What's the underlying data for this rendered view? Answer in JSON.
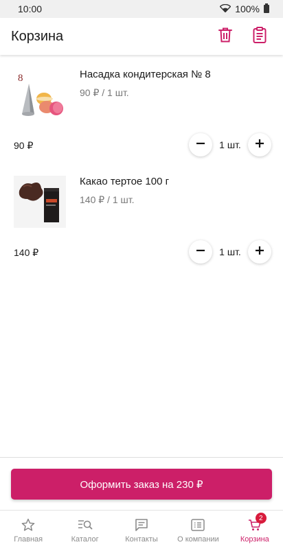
{
  "status_bar": {
    "time": "10:00",
    "battery": "100%"
  },
  "app_bar": {
    "title": "Корзина",
    "icons": [
      "trash-icon",
      "clipboard-icon"
    ]
  },
  "cart": {
    "items": [
      {
        "name": "Насадка кондитерская № 8",
        "unit_price": "90 ₽ / 1 шт.",
        "total": "90 ₽",
        "quantity": "1 шт.",
        "thumb_label": "8"
      },
      {
        "name": "Какао тертое 100 г",
        "unit_price": "140 ₽ / 1 шт.",
        "total": "140 ₽",
        "quantity": "1 шт."
      }
    ]
  },
  "checkout": {
    "label": "Оформить заказ на 230 ₽"
  },
  "bottom_nav": {
    "items": [
      {
        "label": "Главная",
        "icon": "star-icon"
      },
      {
        "label": "Каталог",
        "icon": "catalog-search-icon"
      },
      {
        "label": "Контакты",
        "icon": "chat-icon"
      },
      {
        "label": "О компании",
        "icon": "list-icon"
      },
      {
        "label": "Корзина",
        "icon": "cart-icon",
        "badge": "2",
        "active": true
      }
    ]
  },
  "colors": {
    "accent": "#cc1f68",
    "badge": "#d81b3c",
    "muted_text": "#777777"
  }
}
